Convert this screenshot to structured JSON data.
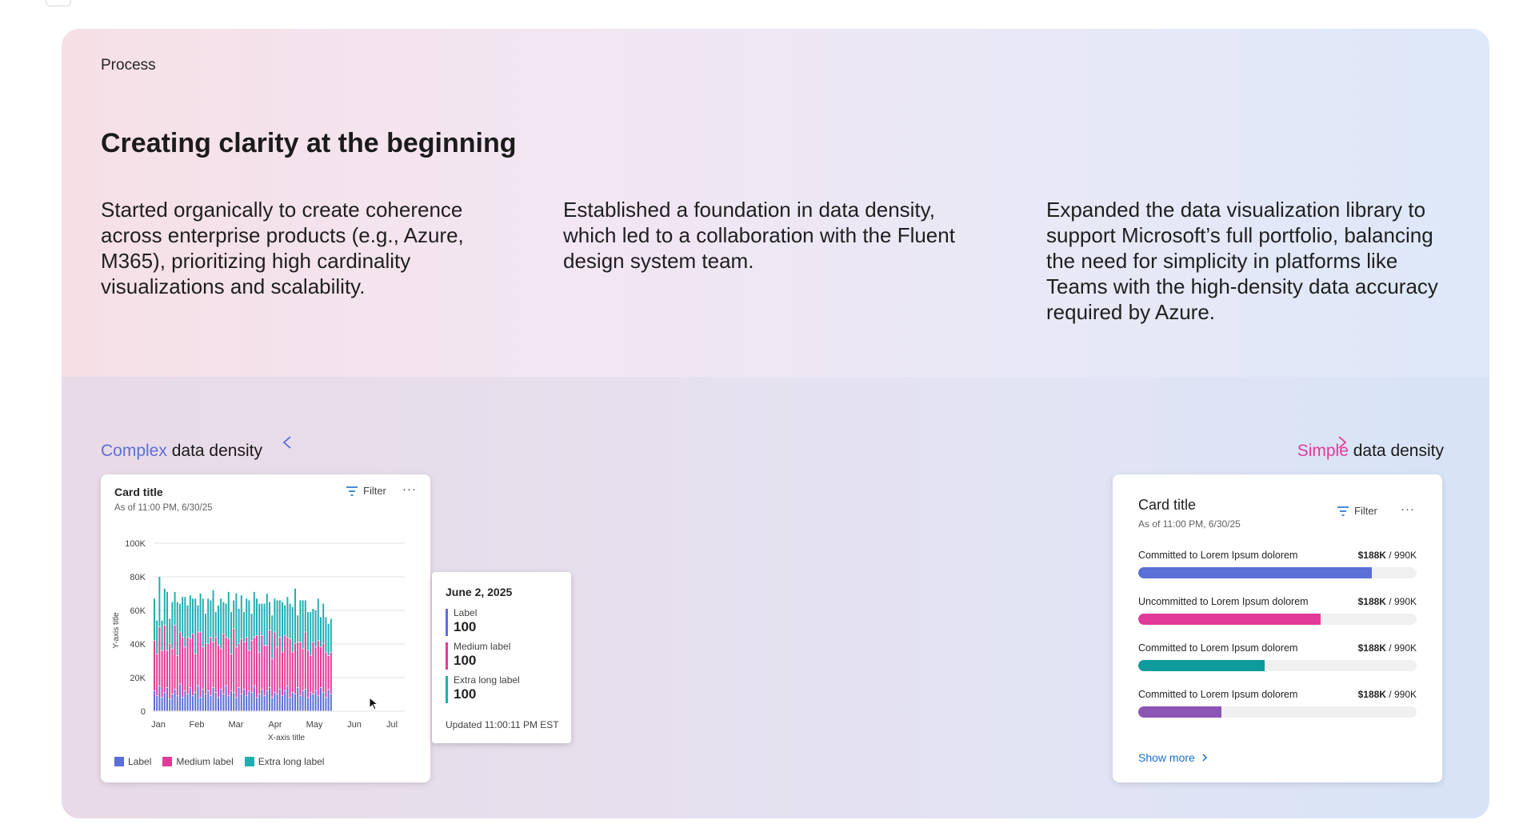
{
  "section_label": "Process",
  "headline": "Creating clarity at the beginning",
  "paragraphs": [
    "Started organically to create coherence across enterprise products (e.g., Azure, M365), prioritizing high cardinality visualizations and scalability.",
    "Established a foundation in data density, which led to a collaboration with the Fluent design system team.",
    "Expanded the data visualization library to support Microsoft’s full portfolio, balancing the need for simplicity in platforms like Teams with the high-density data accuracy required by Azure."
  ],
  "density": {
    "left_keyword": "Complex",
    "left_rest": " data density",
    "right_keyword": "Simple",
    "right_rest": " data density"
  },
  "colors": {
    "label": "#5b6fd6",
    "medium": "#e23a98",
    "extra": "#22aeb0",
    "complex": "#5b6fd6",
    "simple": "#e23a98"
  },
  "left_card": {
    "title": "Card title",
    "subtitle": "As of 11:00 PM, 6/30/25",
    "filter_label": "Filter",
    "more_label": "···",
    "legend": [
      "Label",
      "Medium label",
      "Extra long label"
    ],
    "tooltip": {
      "date": "June 2, 2025",
      "items": [
        {
          "label": "Label",
          "value": "100"
        },
        {
          "label": "Medium label",
          "value": "100"
        },
        {
          "label": "Extra long label",
          "value": "100"
        }
      ],
      "updated": "Updated 11:00:11 PM EST"
    }
  },
  "right_card": {
    "title": "Card title",
    "subtitle": "As of 11:00 PM, 6/30/25",
    "filter_label": "Filter",
    "more_label": "···",
    "rows": [
      {
        "label": "Committed to Lorem Ipsum dolorem",
        "value_bold": "$188K",
        "value_rest": " / 990K",
        "fill": 0.84,
        "color": "#5b6fd6"
      },
      {
        "label": "Uncommitted to Lorem Ipsum dolorem",
        "value_bold": "$188K",
        "value_rest": " / 990K",
        "fill": 0.655,
        "color": "#e23a98"
      },
      {
        "label": "Committed to Lorem Ipsum dolorem",
        "value_bold": "$188K",
        "value_rest": " / 990K",
        "fill": 0.455,
        "color": "#0f9a9c"
      },
      {
        "label": "Committed to Lorem Ipsum dolorem",
        "value_bold": "$188K",
        "value_rest": " / 990K",
        "fill": 0.3,
        "color": "#8a55b5"
      }
    ],
    "show_more": "Show more"
  },
  "chart_data": {
    "type": "bar",
    "stacked": true,
    "xlabel": "X-axis title",
    "ylabel": "Y-axis title",
    "ylim": [
      0,
      100000
    ],
    "yticks": [
      "0",
      "20K",
      "40K",
      "60K",
      "80K",
      "100K"
    ],
    "xticks": [
      "Jan",
      "Feb",
      "Mar",
      "Apr",
      "May",
      "Jun",
      "Jul"
    ],
    "series": [
      {
        "name": "Label",
        "values": [
          12000,
          9000,
          15000,
          8000,
          11000,
          14000,
          7000,
          10000,
          13000,
          9000,
          16000,
          8000,
          12000,
          10000,
          14000,
          9000,
          11000,
          15000,
          8000,
          13000,
          10000,
          12000,
          9000,
          14000,
          11000,
          8000,
          13000,
          10000,
          15000,
          9000,
          12000,
          11000,
          8000,
          14000,
          10000,
          13000,
          9000,
          12000,
          11000,
          15000,
          8000,
          10000,
          13000,
          9000,
          12000,
          14000,
          8000,
          11000,
          10000,
          13000,
          9000,
          12000,
          15000,
          8000,
          11000,
          10000,
          14000,
          9000,
          12000,
          13000,
          8000,
          11000,
          10000,
          12000,
          9000,
          14000,
          11000,
          8000,
          13000,
          10000
        ]
      },
      {
        "name": "Medium label",
        "values": [
          30000,
          25000,
          35000,
          28000,
          40000,
          22000,
          33000,
          27000,
          38000,
          24000,
          31000,
          36000,
          26000,
          34000,
          29000,
          37000,
          23000,
          32000,
          39000,
          25000,
          30000,
          28000,
          35000,
          27000,
          33000,
          31000,
          24000,
          36000,
          29000,
          34000,
          22000,
          38000,
          30000,
          26000,
          33000,
          28000,
          35000,
          24000,
          31000,
          29000,
          37000,
          25000,
          32000,
          30000,
          27000,
          34000,
          23000,
          36000,
          28000,
          31000,
          26000,
          33000,
          29000,
          35000,
          24000,
          30000,
          27000,
          32000,
          25000,
          34000,
          28000,
          22000,
          31000,
          26000,
          33000,
          24000,
          29000,
          27000,
          20000,
          25000
        ]
      },
      {
        "name": "Extra long label",
        "values": [
          25000,
          20000,
          30000,
          18000,
          22000,
          35000,
          15000,
          28000,
          20000,
          32000,
          17000,
          24000,
          30000,
          19000,
          26000,
          21000,
          33000,
          16000,
          23000,
          29000,
          18000,
          27000,
          22000,
          31000,
          15000,
          24000,
          30000,
          19000,
          20000,
          28000,
          25000,
          17000,
          32000,
          21000,
          26000,
          18000,
          23000,
          30000,
          16000,
          27000,
          22000,
          29000,
          19000,
          25000,
          31000,
          17000,
          26000,
          20000,
          28000,
          22000,
          30000,
          18000,
          24000,
          21000,
          27000,
          33000,
          16000,
          25000,
          29000,
          19000,
          23000,
          26000,
          20000,
          22000,
          25000,
          18000,
          24000,
          21000,
          19000,
          20000
        ]
      }
    ]
  }
}
